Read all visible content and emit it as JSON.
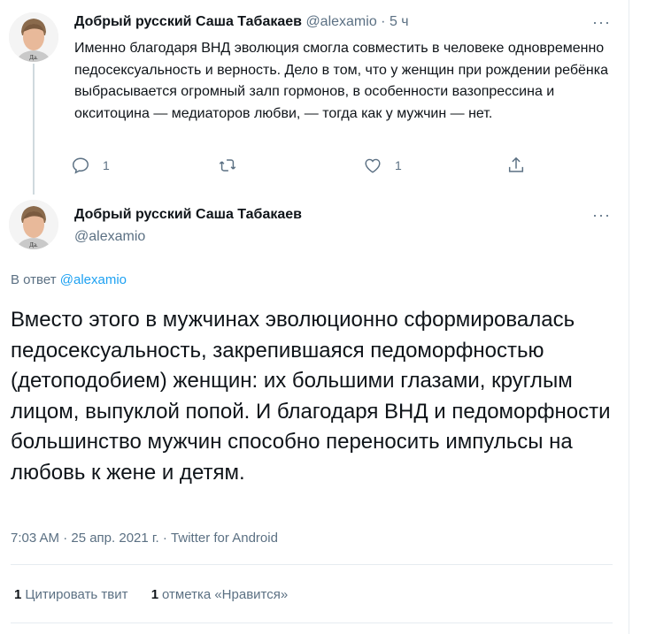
{
  "tweet1": {
    "name": "Добрый русский Саша Табакаев",
    "handle": "@alexamio",
    "time": "· 5 ч",
    "text": "Именно благодаря ВНД эволюция смогла совместить в человеке одновременно педосексуальность и верность. Дело в том, что у женщин при рождении ребёнка выбрасывается огромный залп гормонов, в особенности вазопрессина и окситоцина — медиаторов любви, — тогда как у мужчин — нет.",
    "avatar_caption": "Да.",
    "actions": {
      "reply_count": "1",
      "retweet_count": "",
      "like_count": "1"
    },
    "more": "···"
  },
  "tweet2": {
    "name": "Добрый русский Саша Табакаев",
    "handle": "@alexamio",
    "avatar_caption": "Да.",
    "more": "···",
    "reply_prefix": "В ответ ",
    "reply_mention": "@alexamio",
    "text": "Вместо этого в мужчинах эволюционно сформировалась педосексуальность, закрепившаяся педоморфностью (детоподобием) женщин: их большими глазами, круглым лицом, выпуклой попой. И благодаря ВНД и педоморфности большинство мужчин способно переносить импульсы на любовь к жене и детям.",
    "meta": "7:03 AM · 25 апр. 2021 г. · Twitter for Android",
    "quote_count": "1",
    "quote_label": "Цитировать твит",
    "like_count": "1",
    "like_label": "отметка «Нравится»"
  },
  "colors": {
    "accent": "#1da1f2",
    "secondary_text": "#5b7083",
    "primary_text": "#0f1419",
    "divider": "#e6ecf0"
  },
  "icons": [
    "reply-icon",
    "retweet-icon",
    "like-icon",
    "share-icon",
    "more-icon"
  ]
}
